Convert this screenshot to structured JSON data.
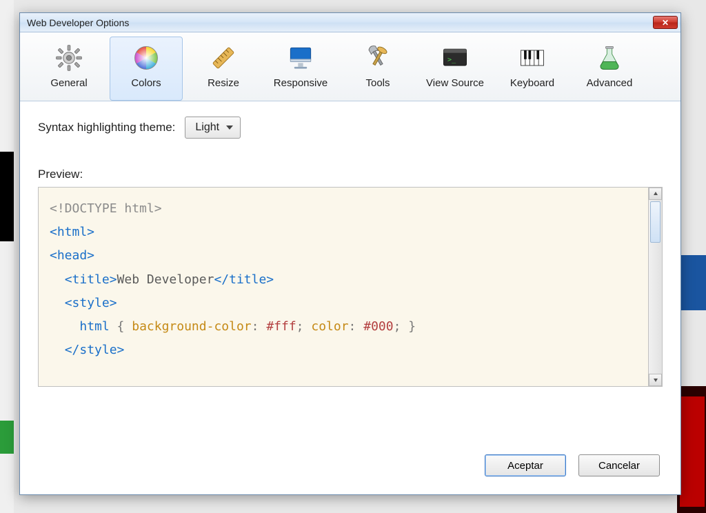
{
  "dialog": {
    "title": "Web Developer Options"
  },
  "tabs": [
    {
      "id": "general",
      "label": "General",
      "selected": false
    },
    {
      "id": "colors",
      "label": "Colors",
      "selected": true
    },
    {
      "id": "resize",
      "label": "Resize",
      "selected": false
    },
    {
      "id": "responsive",
      "label": "Responsive",
      "selected": false
    },
    {
      "id": "tools",
      "label": "Tools",
      "selected": false
    },
    {
      "id": "viewsource",
      "label": "View Source",
      "selected": false
    },
    {
      "id": "keyboard",
      "label": "Keyboard",
      "selected": false
    },
    {
      "id": "advanced",
      "label": "Advanced",
      "selected": false
    }
  ],
  "theme": {
    "label": "Syntax highlighting theme:",
    "value": "Light"
  },
  "preview_label": "Preview:",
  "code": {
    "l1_doctype": "<!DOCTYPE html>",
    "l2_open": "<html>",
    "l3_open": "<head>",
    "l4_open": "<title>",
    "l4_text": "Web Developer",
    "l4_close": "</title>",
    "l5_open": "<style>",
    "l6_sel": "html",
    "l6_b1": " { ",
    "l6_p1": "background-color",
    "l6_c": ": ",
    "l6_v1": "#fff",
    "l6_s": "; ",
    "l6_p2": "color",
    "l6_c2": ": ",
    "l6_v2": "#000",
    "l6_e": "; }",
    "l7_close": "</style>"
  },
  "buttons": {
    "ok": "Aceptar",
    "cancel": "Cancelar"
  }
}
